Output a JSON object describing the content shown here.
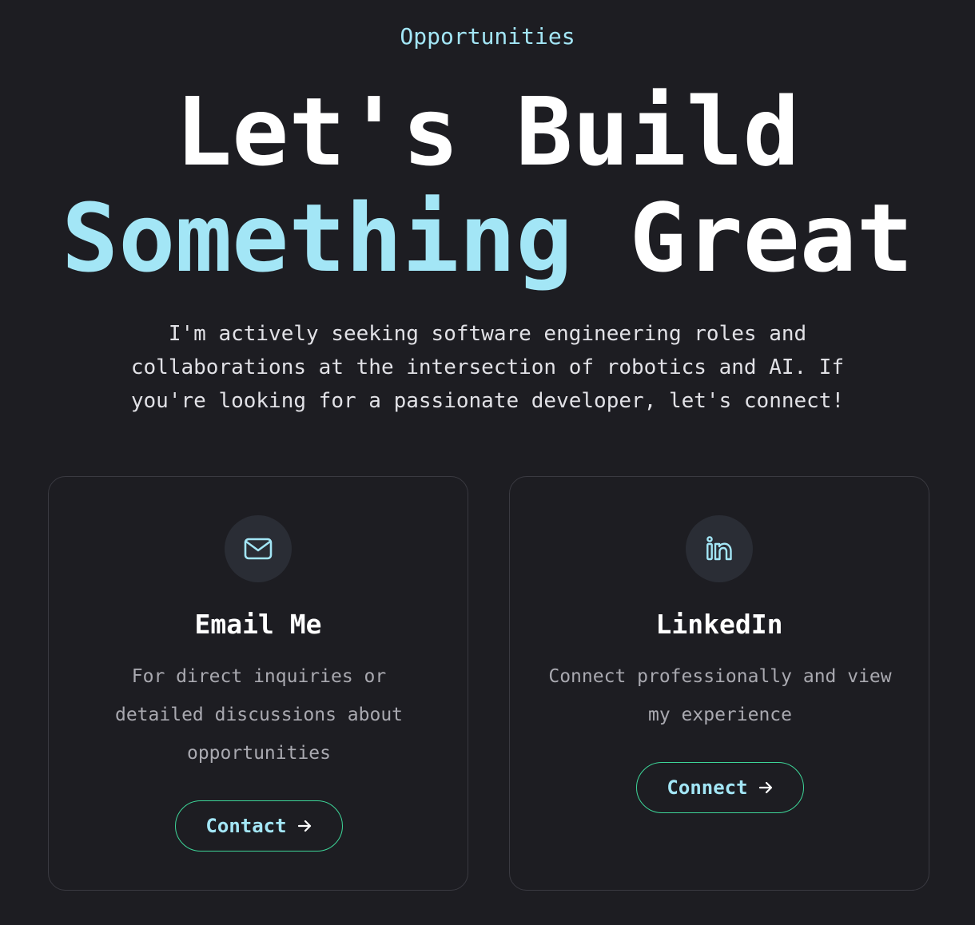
{
  "section": {
    "eyebrow": "Opportunities",
    "headline_line1": "Let's Build",
    "headline_accent": "Something",
    "headline_rest": "Great",
    "intro": "I'm actively seeking software engineering roles and collaborations at the intersection of robotics and AI. If you're looking for a passionate developer, let's connect!"
  },
  "cards": {
    "email": {
      "icon": "mail-icon",
      "title": "Email Me",
      "description": "For direct inquiries or detailed discussions about opportunities",
      "button_label": "Contact",
      "button_icon": "arrow-right-icon"
    },
    "linkedin": {
      "icon": "linkedin-icon",
      "title": "LinkedIn",
      "description": "Connect professionally and view my experience",
      "button_label": "Connect",
      "button_icon": "arrow-right-icon"
    }
  },
  "colors": {
    "background": "#1d1d22",
    "accent": "#a3e6f6",
    "button_border": "#3dd598",
    "card_border": "#3a3a41",
    "icon_circle": "#2a2d35"
  }
}
